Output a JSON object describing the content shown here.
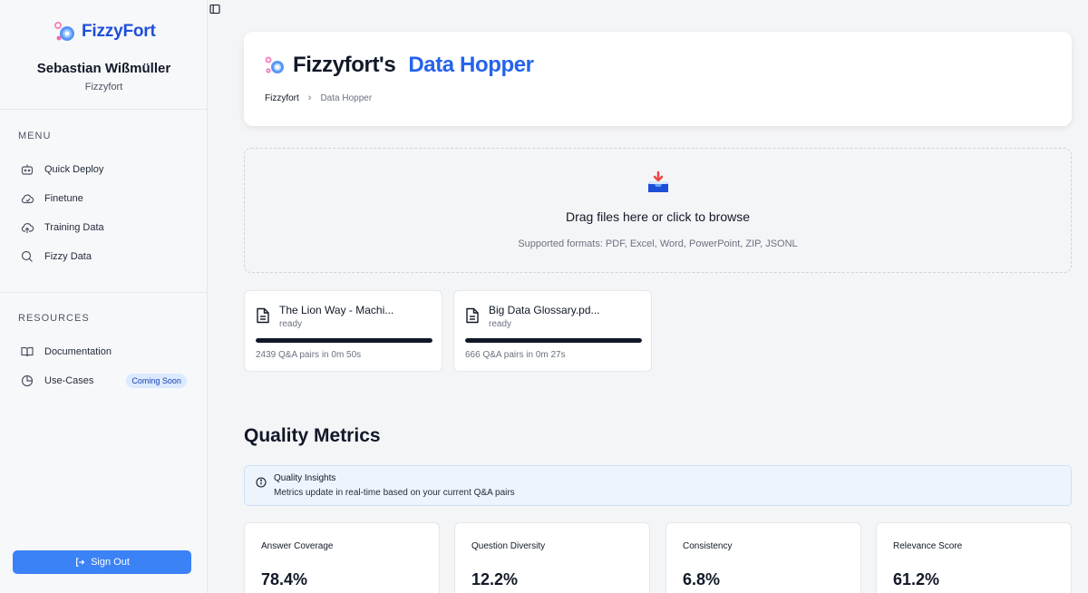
{
  "app": {
    "logo_text": "FizzyFort",
    "user_name": "Sebastian Wißmüller",
    "user_org": "Fizzyfort"
  },
  "sidebar": {
    "menu_label": "MENU",
    "menu_items": [
      {
        "label": "Quick Deploy",
        "icon": "bot-icon"
      },
      {
        "label": "Finetune",
        "icon": "cloud-icon"
      },
      {
        "label": "Training Data",
        "icon": "cloud-upload-icon"
      },
      {
        "label": "Fizzy Data",
        "icon": "search-icon"
      }
    ],
    "resources_label": "RESOURCES",
    "resource_items": [
      {
        "label": "Documentation",
        "icon": "book-icon"
      },
      {
        "label": "Use-Cases",
        "icon": "pie-chart-icon",
        "badge": "Coming Soon"
      }
    ],
    "signout_label": "Sign Out"
  },
  "header": {
    "title_main": "Fizzyfort's",
    "title_accent": "Data Hopper",
    "breadcrumb": [
      "Fizzyfort",
      "Data Hopper"
    ]
  },
  "dropzone": {
    "title": "Drag files here or click to browse",
    "subtitle": "Supported formats: PDF, Excel, Word, PowerPoint, ZIP, JSONL"
  },
  "files": [
    {
      "name": "The Lion Way - Machi...",
      "status": "ready",
      "progress": 100,
      "meta": "2439 Q&A pairs in 0m 50s"
    },
    {
      "name": "Big Data Glossary.pd...",
      "status": "ready",
      "progress": 100,
      "meta": "666 Q&A pairs in 0m 27s"
    }
  ],
  "quality": {
    "title": "Quality Metrics",
    "insights_title": "Quality Insights",
    "insights_text": "Metrics update in real-time based on your current Q&A pairs",
    "metrics": [
      {
        "label": "Answer Coverage",
        "value": "78.4%"
      },
      {
        "label": "Question Diversity",
        "value": "12.2%"
      },
      {
        "label": "Consistency",
        "value": "6.8%"
      },
      {
        "label": "Relevance Score",
        "value": "61.2%"
      }
    ]
  },
  "colors": {
    "accent": "#2563eb",
    "brand": "#1e4fd8",
    "signout": "#3b82f6"
  }
}
